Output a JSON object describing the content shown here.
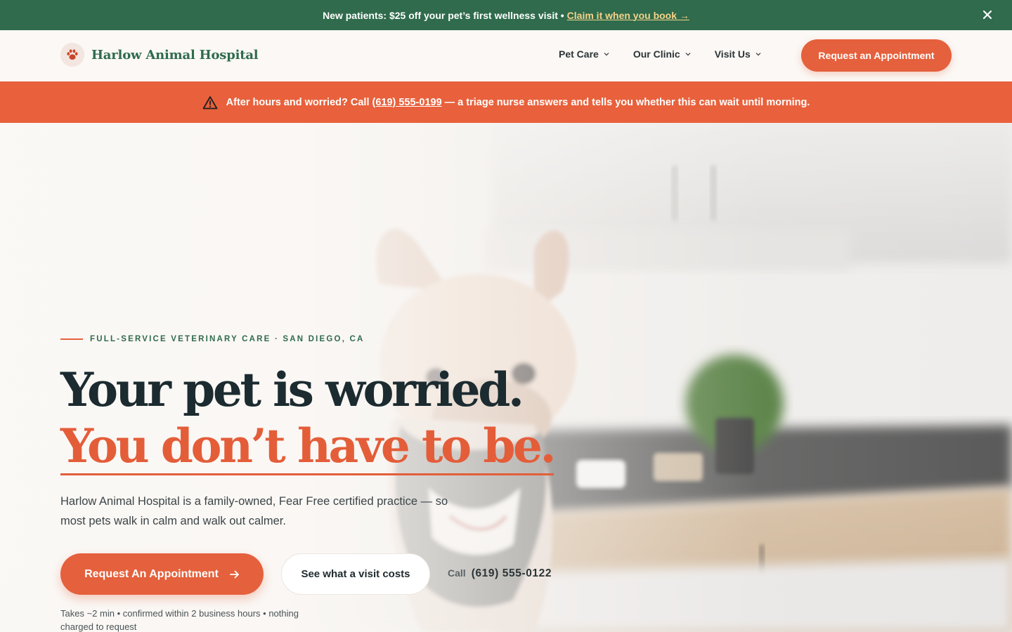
{
  "colors": {
    "brand_green": "#2f6b4c",
    "accent_orange": "#e5603c",
    "ink": "#1b2b30"
  },
  "promo": {
    "text": "New patients: $25 off your pet’s first wellness visit •",
    "link": "Claim it when you book →",
    "close_icon": "close-icon"
  },
  "header": {
    "logo_icon": "paw-icon",
    "brand": "Harlow Animal Hospital",
    "nav": [
      {
        "label": "Pet Care",
        "icon": "chevron-down-icon"
      },
      {
        "label": "Our Clinic",
        "icon": "chevron-down-icon"
      },
      {
        "label": "Visit Us",
        "icon": "chevron-down-icon"
      }
    ],
    "cta": "Request an Appointment"
  },
  "alert": {
    "icon": "warning-icon",
    "before": "After hours and worried? Call",
    "phone": "(619) 555-0199",
    "after": "— a triage nurse answers and tells you whether this can wait until morning."
  },
  "hero": {
    "eyebrow": "FULL-SERVICE VETERINARY CARE · SAN DIEGO, CA",
    "headline_1": "Your pet is worried.",
    "headline_2": "You don’t have to be.",
    "lede": "Harlow Animal Hospital is a family-owned, Fear Free certified practice — so most pets walk in calm and walk out calmer.",
    "primary_cta": "Request An Appointment",
    "primary_cta_icon": "arrow-right-icon",
    "secondary_cta": "See what a visit costs",
    "call_label": "Call",
    "call_number": "(619) 555-0122",
    "fine_print": "Takes ~2 min • confirmed within 2 business hours • nothing charged to request"
  }
}
